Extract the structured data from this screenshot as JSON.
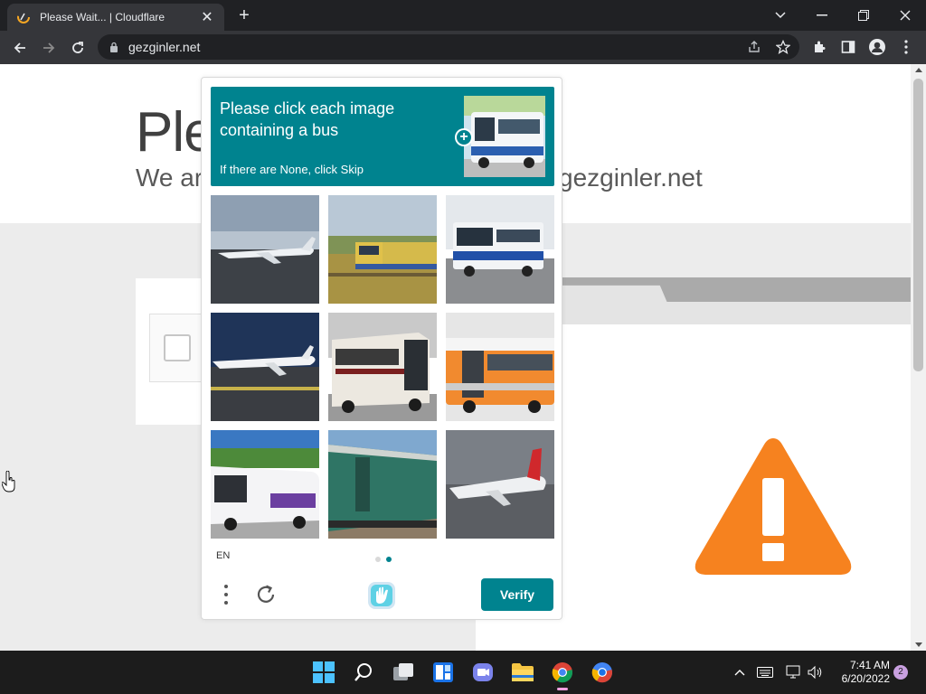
{
  "browser": {
    "tab_title": "Please Wait... | Cloudflare",
    "url": "gezginler.net"
  },
  "page": {
    "heading": "Ple",
    "subheading_left": "We ar",
    "subheading_right": "gezginler.net"
  },
  "captcha": {
    "prompt": "Please click each image containing a bus",
    "hint": "If there are None, click Skip",
    "language": "EN",
    "verify_label": "Verify",
    "page_count": 2,
    "active_page": 2,
    "accent_color": "#00838f",
    "tiles": [
      {
        "subject": "airplane"
      },
      {
        "subject": "train"
      },
      {
        "subject": "bus"
      },
      {
        "subject": "airplane"
      },
      {
        "subject": "bus"
      },
      {
        "subject": "bus"
      },
      {
        "subject": "bus"
      },
      {
        "subject": "train"
      },
      {
        "subject": "airplane"
      }
    ]
  },
  "taskbar": {
    "time": "7:41 AM",
    "date": "6/20/2022",
    "notification_count": "2",
    "apps": [
      "start-icon",
      "search-icon",
      "task-view-icon",
      "widgets-icon",
      "chat-icon",
      "file-explorer-icon",
      "chrome-icon",
      "chrome-beta-icon"
    ]
  }
}
